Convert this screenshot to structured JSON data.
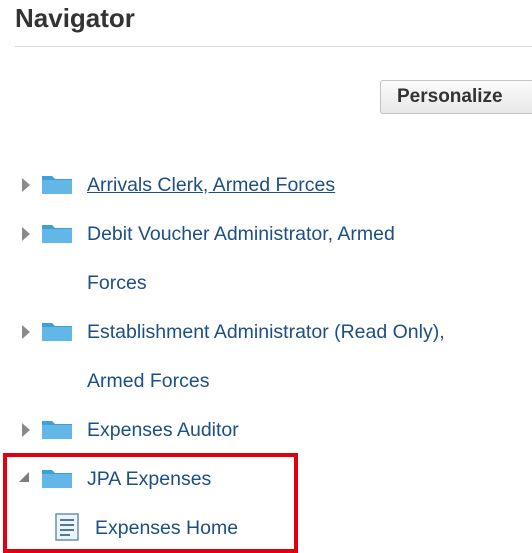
{
  "header": {
    "title": "Navigator"
  },
  "toolbar": {
    "personalize_label": "Personalize"
  },
  "tree": {
    "items": [
      {
        "label": "Arrivals Clerk, Armed Forces",
        "state": "collapsed",
        "icon": "folder-icon"
      },
      {
        "label_line1": "Debit Voucher Administrator, Armed",
        "label_line2": "Forces",
        "state": "collapsed",
        "icon": "folder-icon"
      },
      {
        "label_line1": "Establishment Administrator (Read Only),",
        "label_line2": "Armed Forces",
        "state": "collapsed",
        "icon": "folder-icon"
      },
      {
        "label": "Expenses Auditor",
        "state": "collapsed",
        "icon": "folder-icon"
      },
      {
        "label": "JPA Expenses",
        "state": "expanded",
        "icon": "folder-icon"
      },
      {
        "label": "Expenses Home",
        "icon": "page-icon"
      }
    ]
  },
  "colors": {
    "link": "#1c4f86",
    "folder": "#3fa0d8",
    "highlight": "#e2000f"
  }
}
